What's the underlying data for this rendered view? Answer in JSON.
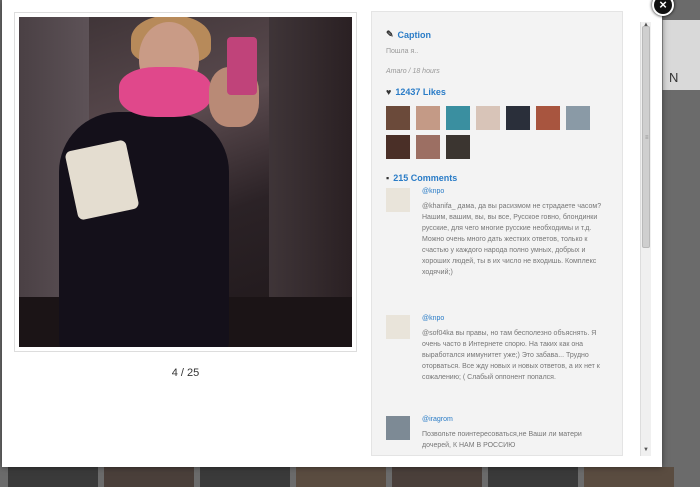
{
  "background": {
    "right_box_text": "N"
  },
  "modal": {
    "close_label": "×",
    "pager": "4 / 25"
  },
  "caption": {
    "heading": "Caption",
    "text": "Пошла я..",
    "meta": "Amaro / 18 hours"
  },
  "likes": {
    "heading": "12437 Likes",
    "avatars": [
      {
        "color": "#6b4a3a"
      },
      {
        "color": "#c49a86"
      },
      {
        "color": "#3a8fa0"
      },
      {
        "color": "#d8c4b8"
      },
      {
        "color": "#2a2f3a"
      },
      {
        "color": "#a8553f"
      },
      {
        "color": "#8a9aa6"
      },
      {
        "color": "#4a2f27"
      },
      {
        "color": "#9c6f63"
      },
      {
        "color": "#3b3530"
      }
    ]
  },
  "comments": {
    "heading": "215 Comments",
    "items": [
      {
        "user": "@knpo",
        "text": "@khanifa_ дама, да вы расизмом не страдаете часом? Нашим, вашим, вы, вы все, Русское говно, блондинки русские, для чего многие русские необходимы и т.д. Можно очень много дать жестких ответов, только к счастью у каждого народа полно умных, добрых и хороших людей, ты в их число не входишь. Комплекс ходячий;)",
        "avatar_color": "#e9e4da"
      },
      {
        "user": "@knpo",
        "text": "@sof04ka вы правы, но там бесполезно объяснять. Я очень часто в Интернете спорю. На таких как она выработался иммунитет уже;) Это забава... Трудно оторваться. Все жду новых и новых ответов, а их нет к сожалению; ( Слабый оппонент попался.",
        "avatar_color": "#e9e4da"
      },
      {
        "user": "@iragrom",
        "text": "Позвольте поинтересоваться,не Ваши ли матери дочерей, К НАМ В РОССИЮ",
        "avatar_color": "#7d8a95"
      }
    ]
  }
}
